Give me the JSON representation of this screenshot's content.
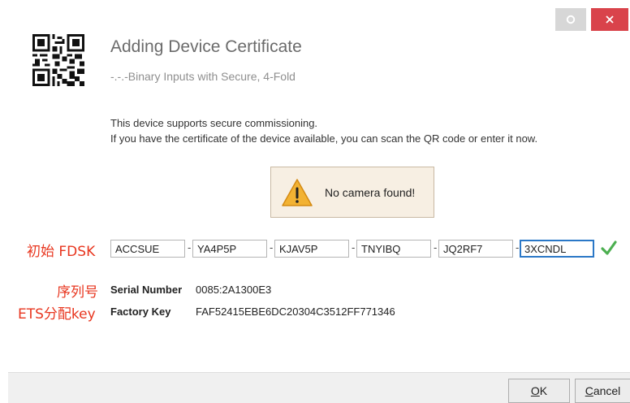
{
  "window": {
    "title": "Adding Device Certificate",
    "subtitle": "-.-.-Binary Inputs with Secure, 4-Fold"
  },
  "info": {
    "line1": "This device supports secure commissioning.",
    "line2": "If you have the certificate of the device available, you can scan the QR code or enter it now."
  },
  "camera": {
    "message": "No camera found!",
    "warning_icon": "warning-triangle-icon"
  },
  "annotations": {
    "fdsk": "初始 FDSK",
    "serial": "序列号",
    "factory": "ETS分配key"
  },
  "fdsk": {
    "segments": [
      "ACCSUE",
      "YA4P5P",
      "KJAV5P",
      "TNYIBQ",
      "JQ2RF7",
      "3XCNDL"
    ],
    "separator": "-"
  },
  "serial": {
    "label": "Serial Number",
    "value": "0085:2A1300E3"
  },
  "factory_key": {
    "label": "Factory Key",
    "value": "FAF52415EBE6DC20304C3512FF771346"
  },
  "buttons": {
    "ok": "OK",
    "cancel": "Cancel"
  },
  "colors": {
    "close_button": "#d9434b",
    "annotation": "#e8361f",
    "valid_check": "#4caf50",
    "focus_border": "#2b78c7"
  }
}
